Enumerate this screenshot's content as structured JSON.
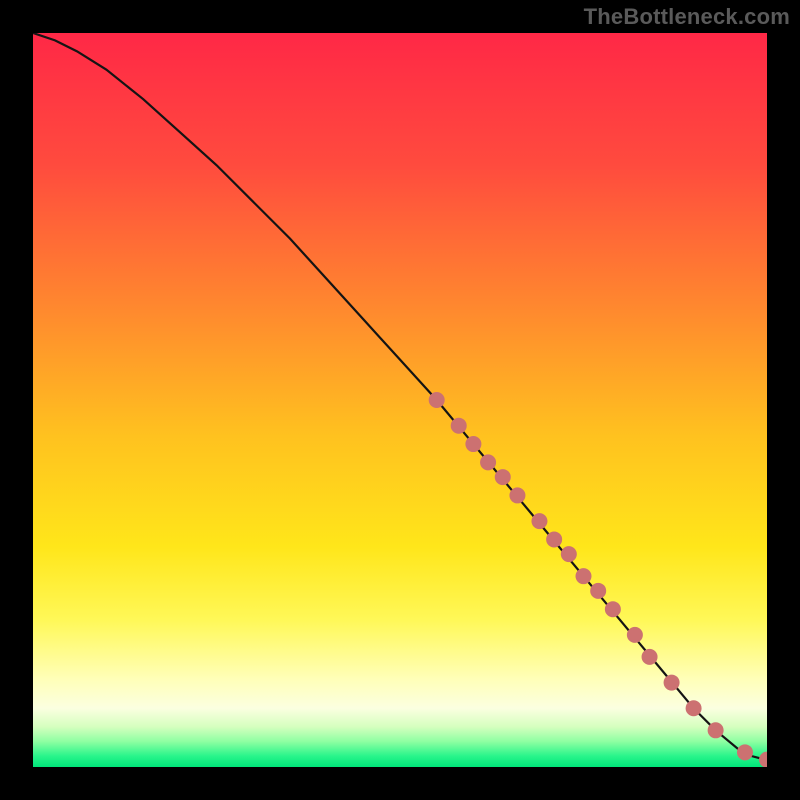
{
  "watermark": "TheBottleneck.com",
  "colors": {
    "background": "#000000",
    "curve": "#141414",
    "marker_fill": "#cc7171",
    "marker_stroke": "#b55f5f",
    "gradient_stops": [
      {
        "offset": 0.0,
        "color": "#ff2846"
      },
      {
        "offset": 0.18,
        "color": "#ff4b3e"
      },
      {
        "offset": 0.38,
        "color": "#ff8a2e"
      },
      {
        "offset": 0.55,
        "color": "#ffc21f"
      },
      {
        "offset": 0.7,
        "color": "#ffe61a"
      },
      {
        "offset": 0.8,
        "color": "#fff858"
      },
      {
        "offset": 0.88,
        "color": "#ffffb8"
      },
      {
        "offset": 0.92,
        "color": "#fbffe0"
      },
      {
        "offset": 0.945,
        "color": "#d6ffbf"
      },
      {
        "offset": 0.965,
        "color": "#8fffa2"
      },
      {
        "offset": 0.985,
        "color": "#29f58b"
      },
      {
        "offset": 1.0,
        "color": "#00e57a"
      }
    ]
  },
  "chart_data": {
    "type": "line",
    "title": "",
    "xlabel": "",
    "ylabel": "",
    "xlim": [
      0,
      100
    ],
    "ylim": [
      0,
      100
    ],
    "series": [
      {
        "name": "bottleneck-curve",
        "x": [
          0,
          3,
          6,
          10,
          15,
          20,
          25,
          30,
          35,
          40,
          45,
          50,
          55,
          60,
          65,
          70,
          75,
          80,
          85,
          90,
          93,
          96,
          97.5,
          99,
          100
        ],
        "y": [
          100,
          99,
          97.5,
          95,
          91,
          86.5,
          82,
          77,
          72,
          66.5,
          61,
          55.5,
          50,
          44,
          38,
          32,
          26,
          20,
          14,
          8,
          5,
          2.5,
          1.6,
          1.2,
          1.0
        ]
      }
    ],
    "markers": {
      "name": "highlight-points",
      "x": [
        55,
        58,
        60,
        62,
        64,
        66,
        69,
        71,
        73,
        75,
        77,
        79,
        82,
        84,
        87,
        90,
        93,
        97,
        100
      ],
      "y": [
        50,
        46.5,
        44,
        41.5,
        39.5,
        37,
        33.5,
        31,
        29,
        26,
        24,
        21.5,
        18,
        15,
        11.5,
        8,
        5,
        2,
        1
      ]
    }
  }
}
